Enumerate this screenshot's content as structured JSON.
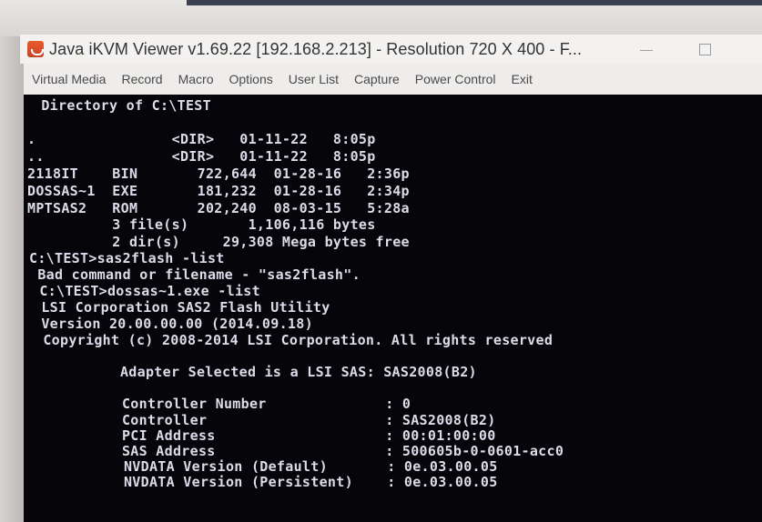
{
  "window": {
    "title": "Java iKVM Viewer v1.69.22 [192.168.2.213]  - Resolution 720 X 400 - F...",
    "minimize_glyph": "—"
  },
  "menu": [
    "Virtual Media",
    "Record",
    "Macro",
    "Options",
    "User List",
    "Capture",
    "Power Control",
    "Exit"
  ],
  "console_lines": [
    " Directory of C:\\TEST",
    ".                <DIR>   01-11-22   8:05p",
    "..               <DIR>   01-11-22   8:05p",
    "2118IT    BIN       722,644  01-28-16   2:36p",
    "DOSSAS~1  EXE       181,232  01-28-16   2:34p",
    "MPTSAS2   ROM       202,240  08-03-15   5:28a",
    "          3 file(s)       1,106,116 bytes",
    "          2 dir(s)     29,308 Mega bytes free",
    "C:\\TEST>sas2flash -list",
    " Bad command or filename - \"sas2flash\".",
    " C:\\TEST>dossas~1.exe -list",
    " LSI Corporation SAS2 Flash Utility",
    " Version 20.00.00.00 (2014.09.18)",
    " Copyright (c) 2008-2014 LSI Corporation. All rights reserved",
    "         Adapter Selected is a LSI SAS: SAS2008(B2)",
    "         Controller Number              : 0",
    "         Controller                     : SAS2008(B2)",
    "         PCI Address                    : 00:01:00:00",
    "         SAS Address                    : 500605b-0-0601-acc0",
    "         NVDATA Version (Default)       : 0e.03.00.05",
    "         NVDATA Version (Persistent)    : 0e.03.00.05"
  ]
}
